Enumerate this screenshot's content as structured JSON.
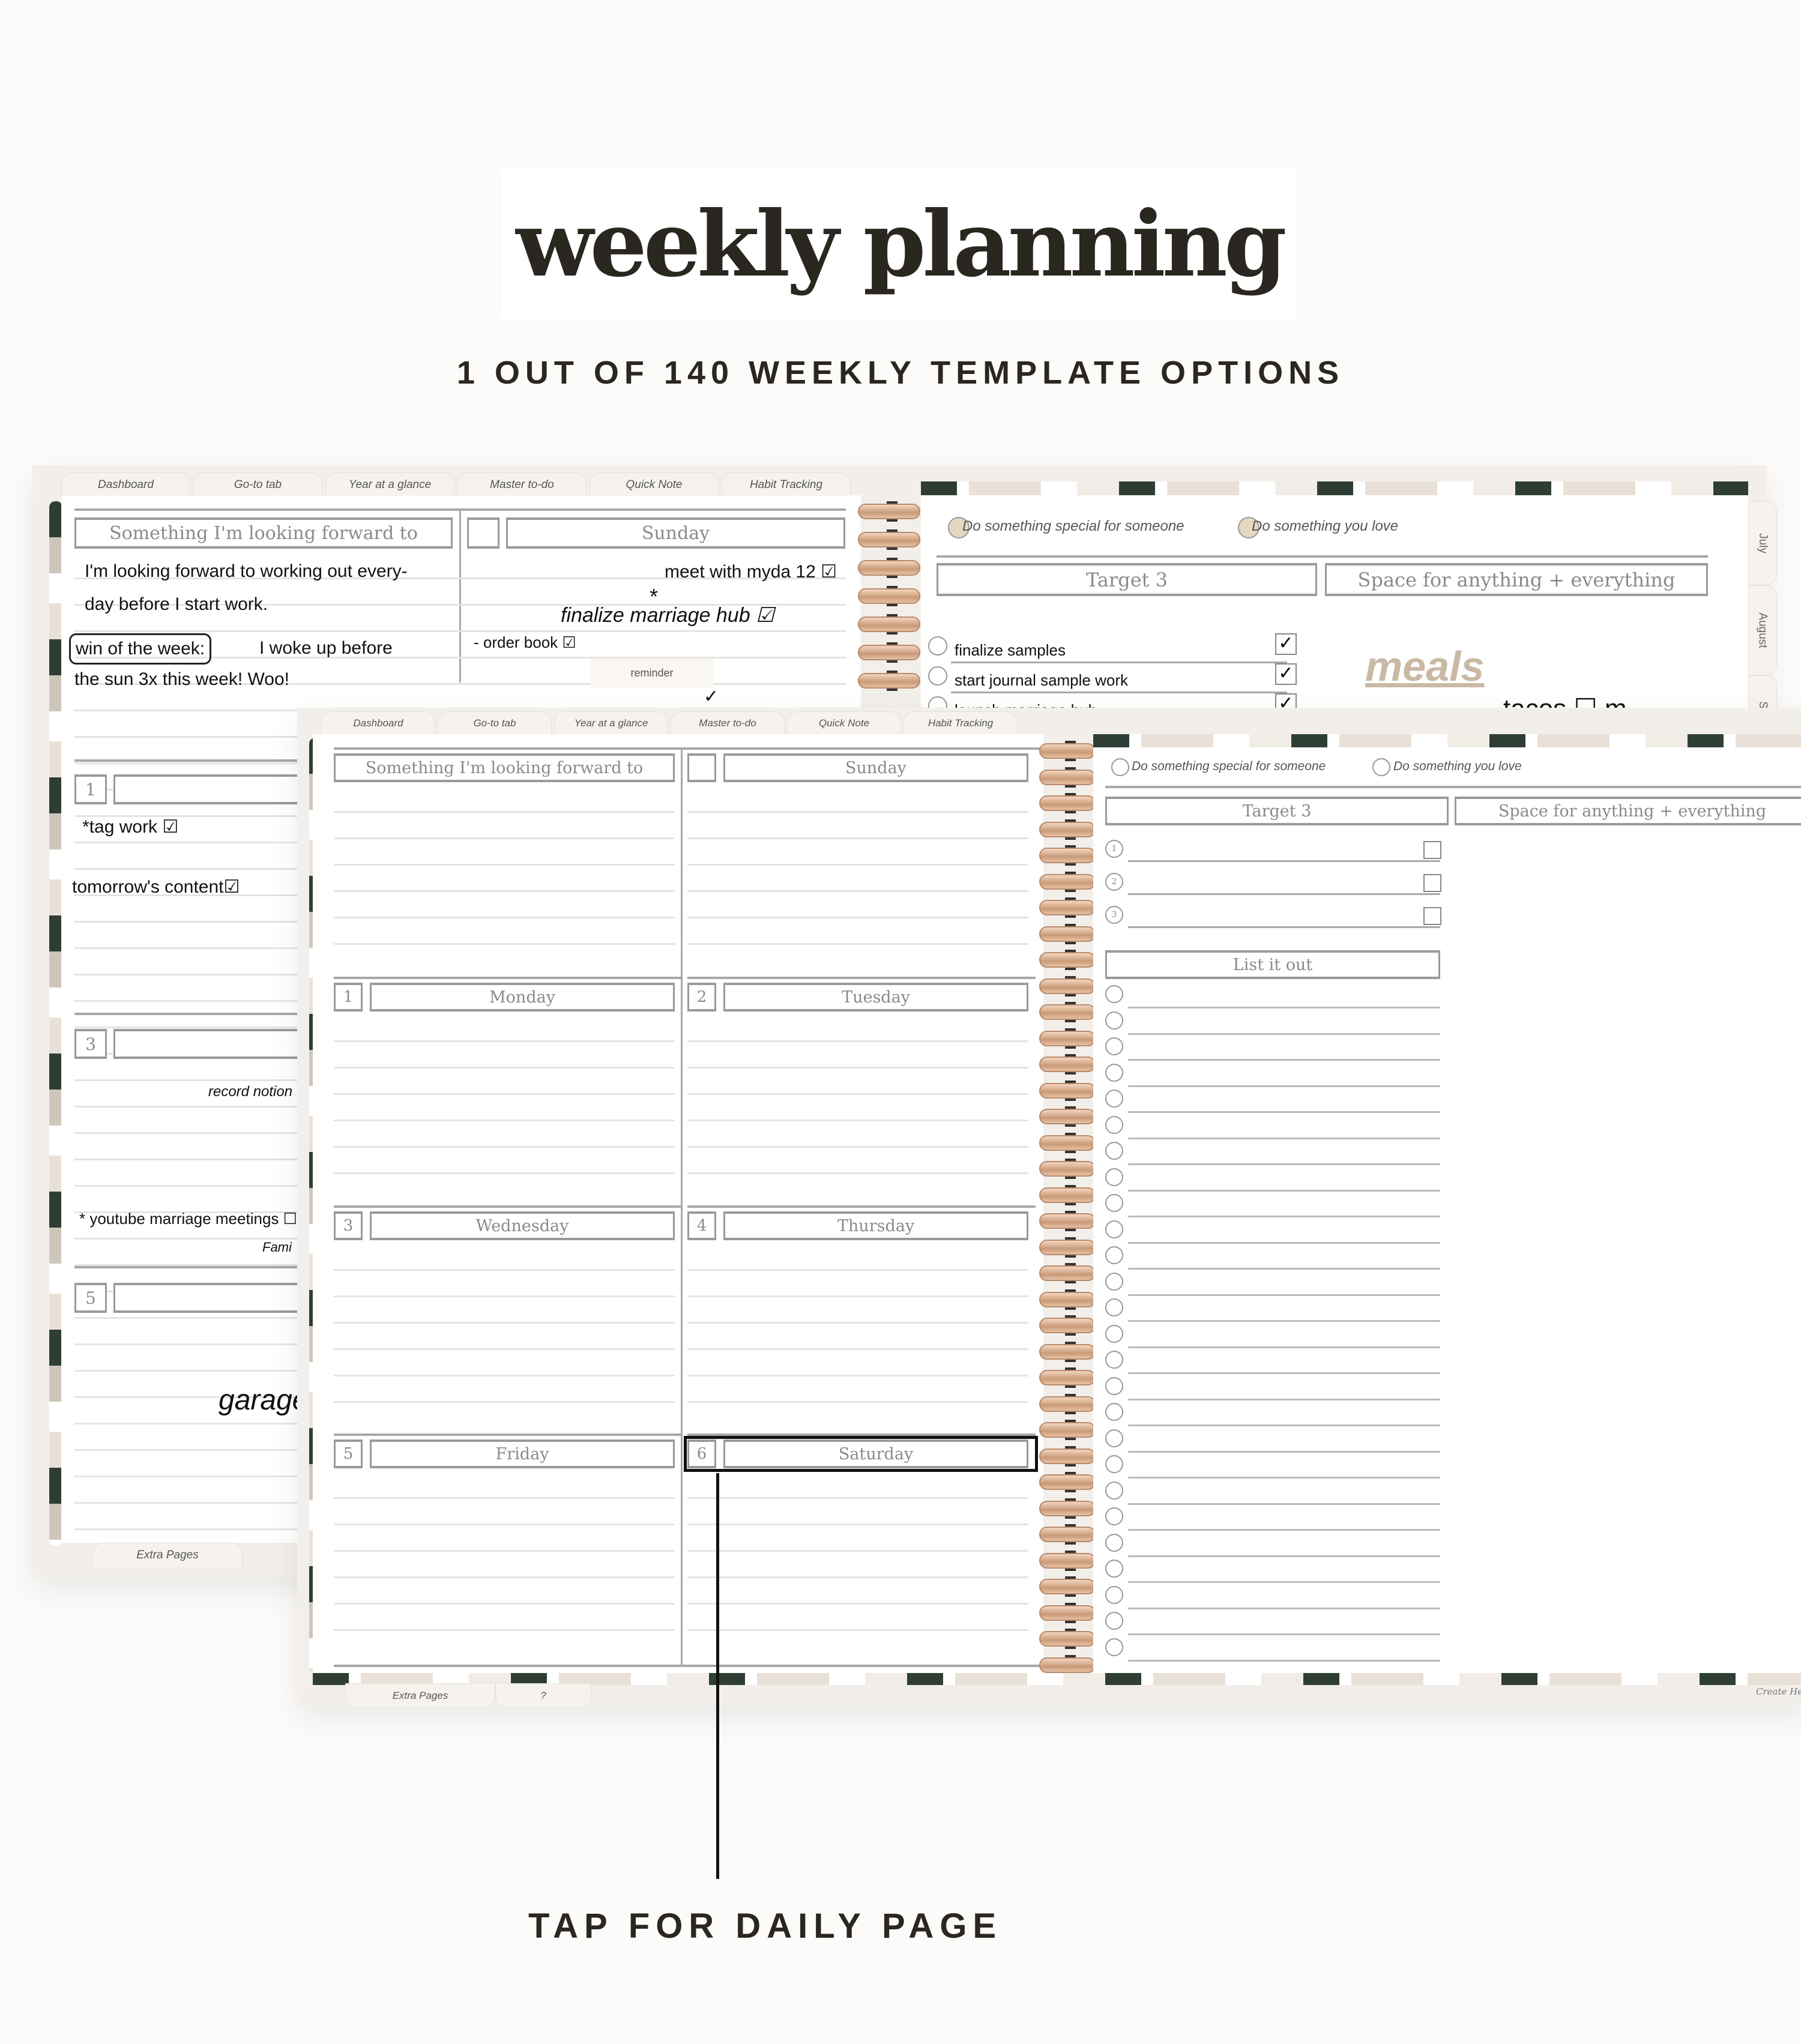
{
  "header": {
    "title": "weekly planning",
    "subtitle": "1 OUT OF 140 WEEKLY TEMPLATE OPTIONS",
    "cta": "TAP FOR DAILY PAGE"
  },
  "colors": {
    "ink": "#2a2620",
    "planner_bg": "#f2efeb",
    "leaf_green": "#2f3e35",
    "beige": "#cfc6bb",
    "meals": "#c9b9a4",
    "spiral": "#d8ab8a"
  },
  "tabs": [
    "Dashboard",
    "Go-to tab",
    "Year at a glance",
    "Master to-do",
    "Quick Note",
    "Habit Tracking"
  ],
  "bottom_tabs": [
    "Extra Pages",
    "?"
  ],
  "month_tabs": [
    "July",
    "August",
    "Sep"
  ],
  "back": {
    "forward_label": "Something I'm looking forward to",
    "sunday_label": "Sunday",
    "forward_notes": [
      "I'm looking forward to working out every-",
      "day before I start work."
    ],
    "win_label": "win of the week:",
    "win_text": "I woke up before",
    "win_text2": "the sun 3x this week! Woo!",
    "sunday_notes": [
      "meet with myda 12 ☑",
      "*",
      "finalize marriage hub ☑",
      "- order book ☑"
    ],
    "reminder": "reminder",
    "check": "✓",
    "days": [
      {
        "num": "1",
        "name": "Monday"
      },
      {
        "num": "3",
        "name": "Wednesday"
      },
      {
        "num": "5",
        "name": "Friday"
      }
    ],
    "monday_notes": [
      "*tag work ☑",
      "tomorrow's content☑"
    ],
    "wednesday_notes": [
      "record notion walk",
      "* youtube marriage meetings ☐",
      "Fami"
    ],
    "friday_notes": [
      "garage s"
    ],
    "checks": [
      "Do something special for someone",
      "Do something you love"
    ],
    "target_label": "Target 3",
    "space_label": "Space for anything + everything",
    "targets": [
      "finalize samples",
      "start journal sample work",
      "launch marriage hub"
    ],
    "meals": "meals",
    "meals_item": "tacos ☐ m"
  },
  "front": {
    "forward_label": "Something I'm looking forward to",
    "days": [
      {
        "num": "",
        "name": "Sunday"
      },
      {
        "num": "1",
        "name": "Monday"
      },
      {
        "num": "2",
        "name": "Tuesday"
      },
      {
        "num": "3",
        "name": "Wednesday"
      },
      {
        "num": "4",
        "name": "Thursday"
      },
      {
        "num": "5",
        "name": "Friday"
      },
      {
        "num": "6",
        "name": "Saturday"
      }
    ],
    "checks": [
      "Do something special for someone",
      "Do something you love"
    ],
    "target_label": "Target 3",
    "space_label": "Space for anything + everything",
    "target_nums": [
      "1",
      "2",
      "3"
    ],
    "list_label": "List it out",
    "list_count": 26,
    "footer": "Create Hea"
  }
}
